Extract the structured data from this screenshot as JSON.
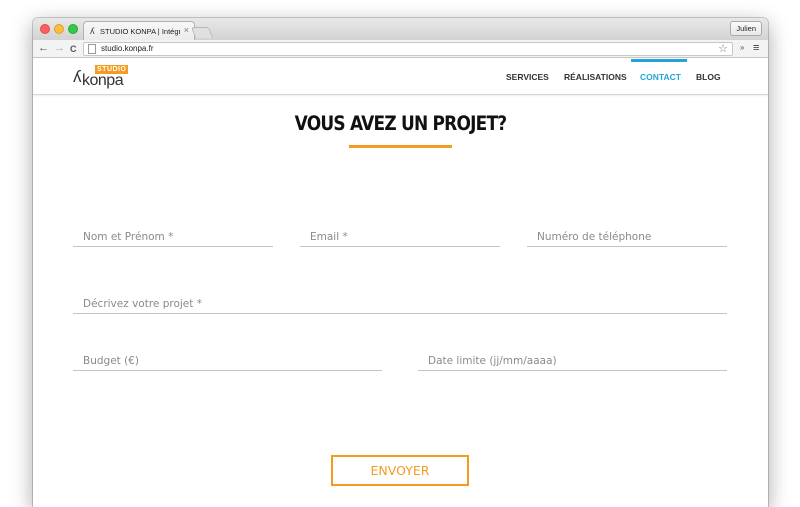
{
  "browser": {
    "tab_title": "STUDIO KONPA | Intégratio",
    "tab_close": "×",
    "profile": "Julien",
    "url": "studio.konpa.fr",
    "ext_label": "»",
    "menu_label": "≡",
    "back": "←",
    "forward": "→",
    "reload": "C",
    "star": "☆"
  },
  "site": {
    "logo_studio": "STUDIO",
    "logo_konpa": "konpa",
    "nav": [
      {
        "label": "SERVICES",
        "active": false
      },
      {
        "label": "RÉALISATIONS",
        "active": false
      },
      {
        "label": "CONTACT",
        "active": true
      },
      {
        "label": "BLOG",
        "active": false
      }
    ],
    "accent_color": "#f39c21",
    "active_color": "#25a3d9"
  },
  "form": {
    "heading": "VOUS AVEZ UN PROJET?",
    "name_placeholder": "Nom et Prénom *",
    "email_placeholder": "Email *",
    "phone_placeholder": "Numéro de téléphone",
    "project_placeholder": "Décrivez votre projet *",
    "budget_placeholder": "Budget (€)",
    "deadline_placeholder": "Date limite (jj/mm/aaaa)",
    "submit_label": "ENVOYER"
  }
}
